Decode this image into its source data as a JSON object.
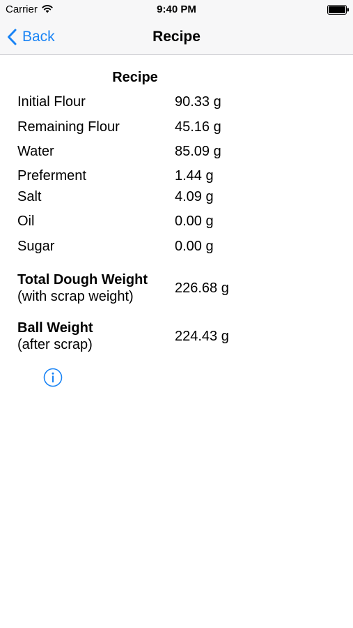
{
  "status_bar": {
    "carrier": "Carrier",
    "time": "9:40 PM"
  },
  "nav": {
    "back_label": "Back",
    "title": "Recipe"
  },
  "section_title": "Recipe",
  "ingredients": [
    {
      "label": "Initial Flour",
      "value": "90.33 g"
    },
    {
      "label": "Remaining Flour",
      "value": "45.16 g"
    },
    {
      "label": "Water",
      "value": "85.09 g"
    },
    {
      "label": "Preferment",
      "value": "1.44 g"
    },
    {
      "label": "Salt",
      "value": "4.09 g"
    },
    {
      "label": "Oil",
      "value": "0.00 g"
    },
    {
      "label": "Sugar",
      "value": "0.00 g"
    }
  ],
  "total_dough": {
    "label": "Total Dough Weight",
    "sublabel": "(with scrap weight)",
    "value": "226.68 g"
  },
  "ball_weight": {
    "label": "Ball Weight",
    "sublabel": "(after scrap)",
    "value": "224.43 g"
  },
  "colors": {
    "accent": "#1a84f5",
    "bar_background": "#f7f7f8"
  },
  "icons": {
    "back": "chevron-left-icon",
    "info": "info-icon",
    "wifi": "wifi-icon",
    "battery": "battery-icon"
  }
}
